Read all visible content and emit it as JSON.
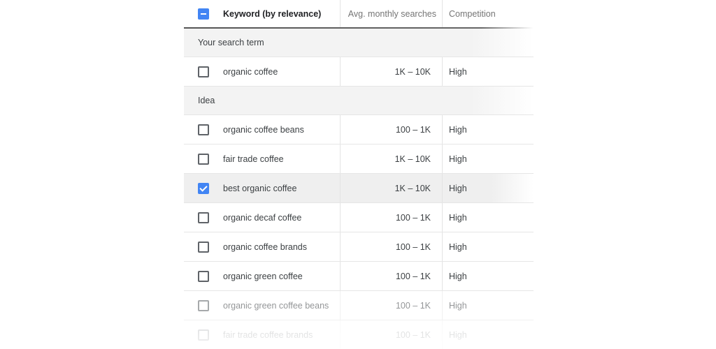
{
  "header": {
    "keyword": "Keyword (by relevance)",
    "searches": "Avg. monthly searches",
    "competition": "Competition",
    "select_all_state": "indeterminate"
  },
  "groups": {
    "search_term": {
      "label": "Your search term",
      "rows": [
        {
          "keyword": "organic coffee",
          "searches": "1K – 10K",
          "competition": "High",
          "checked": false
        }
      ]
    },
    "idea": {
      "label": "Idea",
      "rows": [
        {
          "keyword": "organic coffee beans",
          "searches": "100 – 1K",
          "competition": "High",
          "checked": false
        },
        {
          "keyword": "fair trade coffee",
          "searches": "1K – 10K",
          "competition": "High",
          "checked": false
        },
        {
          "keyword": "best organic coffee",
          "searches": "1K – 10K",
          "competition": "High",
          "checked": true
        },
        {
          "keyword": "organic decaf coffee",
          "searches": "100 – 1K",
          "competition": "High",
          "checked": false
        },
        {
          "keyword": "organic coffee brands",
          "searches": "100 – 1K",
          "competition": "High",
          "checked": false
        },
        {
          "keyword": "organic green coffee",
          "searches": "100 – 1K",
          "competition": "High",
          "checked": false
        },
        {
          "keyword": "organic green coffee beans",
          "searches": "100 – 1K",
          "competition": "High",
          "checked": false
        },
        {
          "keyword": "fair trade coffee brands",
          "searches": "100 – 1K",
          "competition": "High",
          "checked": false
        }
      ]
    }
  },
  "colors": {
    "accent": "#4285f4",
    "text": "#3c4043",
    "group_bg": "#f3f3f3"
  }
}
